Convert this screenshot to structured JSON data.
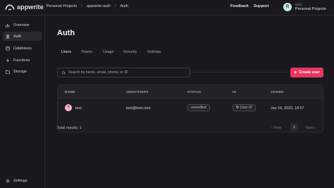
{
  "header": {
    "logo_text": "appwrite",
    "breadcrumbs": [
      "Personal Projects",
      "appwrite-auth",
      "Auth"
    ],
    "links": [
      "Feedback",
      "Support"
    ],
    "avatar_initial": "R",
    "account_name": "Rishi",
    "account_org": "Personal Projects"
  },
  "sidebar": {
    "items": [
      {
        "label": "Overview",
        "icon": "overview-icon"
      },
      {
        "label": "Auth",
        "icon": "auth-icon",
        "active": true
      },
      {
        "label": "Databases",
        "icon": "database-icon"
      },
      {
        "label": "Functions",
        "icon": "functions-icon"
      },
      {
        "label": "Storage",
        "icon": "storage-icon"
      }
    ],
    "settings_label": "Settings"
  },
  "main": {
    "title": "Auth",
    "tabs": [
      "Users",
      "Teams",
      "Usage",
      "Security",
      "Settings"
    ],
    "active_tab": "Users",
    "search_placeholder": "Search by name, email, phone, or ID",
    "create_button": "Create user"
  },
  "table": {
    "columns": [
      "NAME",
      "IDENTIFIERS",
      "STATUS",
      "ID",
      "JOINED"
    ],
    "rows": [
      {
        "avatar": "T",
        "name": "test",
        "identifier": "test@test.com",
        "status": "unverified",
        "id_badge": "User ID",
        "joined": "Jan 16, 2023, 18:57"
      }
    ]
  },
  "footer": {
    "total": "Total results: 1",
    "prev": "Prev",
    "page": "1",
    "next": "Next"
  },
  "colors": {
    "accent": "#fd366e",
    "background": "#19191d"
  }
}
